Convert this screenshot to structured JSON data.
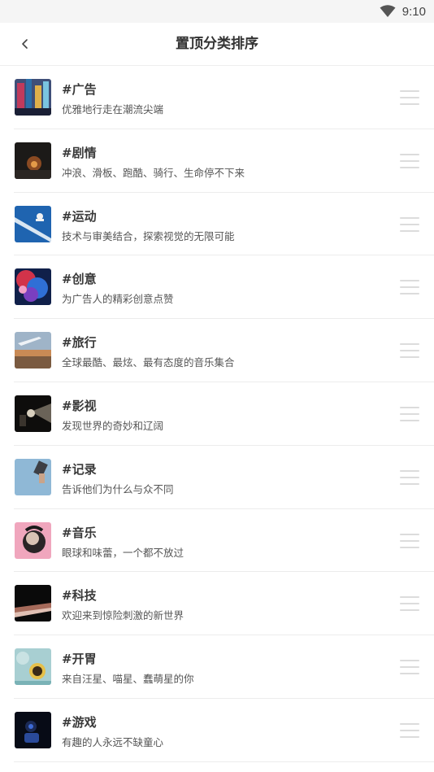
{
  "status_bar": {
    "time": "9:10"
  },
  "nav": {
    "title": "置顶分类排序"
  },
  "categories": [
    {
      "title": "#广告",
      "desc": "优雅地行走在潮流尖端"
    },
    {
      "title": "#剧情",
      "desc": "冲浪、滑板、跑酷、骑行、生命停不下来"
    },
    {
      "title": "#运动",
      "desc": "技术与审美结合，探索视觉的无限可能"
    },
    {
      "title": "#创意",
      "desc": "为广告人的精彩创意点赞"
    },
    {
      "title": "#旅行",
      "desc": "全球最酷、最炫、最有态度的音乐集合"
    },
    {
      "title": "#影视",
      "desc": "发现世界的奇妙和辽阔"
    },
    {
      "title": "#记录",
      "desc": "告诉他们为什么与众不同"
    },
    {
      "title": "#音乐",
      "desc": "眼球和味蕾，一个都不放过"
    },
    {
      "title": "#科技",
      "desc": "欢迎来到惊险刺激的新世界"
    },
    {
      "title": "#开胃",
      "desc": "来自汪星、喵星、蠢萌星的你"
    },
    {
      "title": "#游戏",
      "desc": "有趣的人永远不缺童心"
    }
  ]
}
